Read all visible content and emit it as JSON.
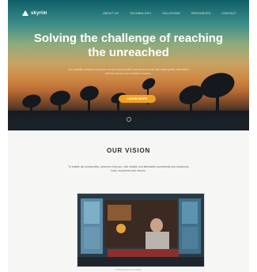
{
  "brand": {
    "name": "skyrim",
    "logo_icon": "triangle-logo-icon"
  },
  "nav": {
    "links": [
      "ABOUT US",
      "TECHNOLOGY",
      "SOLUTIONS",
      "RESOURCES",
      "CONTACT"
    ]
  },
  "hero": {
    "headline_line1": "Solving the challenge of reaching",
    "headline_line2": "the unreached",
    "subtext": "Our satellite network connects remote communities across the world with high-speed, affordable internet access and reliable services.",
    "cta_label": "LEARN MORE"
  },
  "vision": {
    "title": "OUR VISION",
    "text": "To enable all communities, wherever they are, with reliable and affordable connectivity that transforms lives, economies and futures."
  },
  "photo": {
    "caption": "Connecting communities"
  },
  "colors": {
    "accent": "#f0a21e",
    "hero_top": "#0f5f68",
    "hero_mid": "#cf8a44",
    "footer_dark": "#1b2128"
  }
}
